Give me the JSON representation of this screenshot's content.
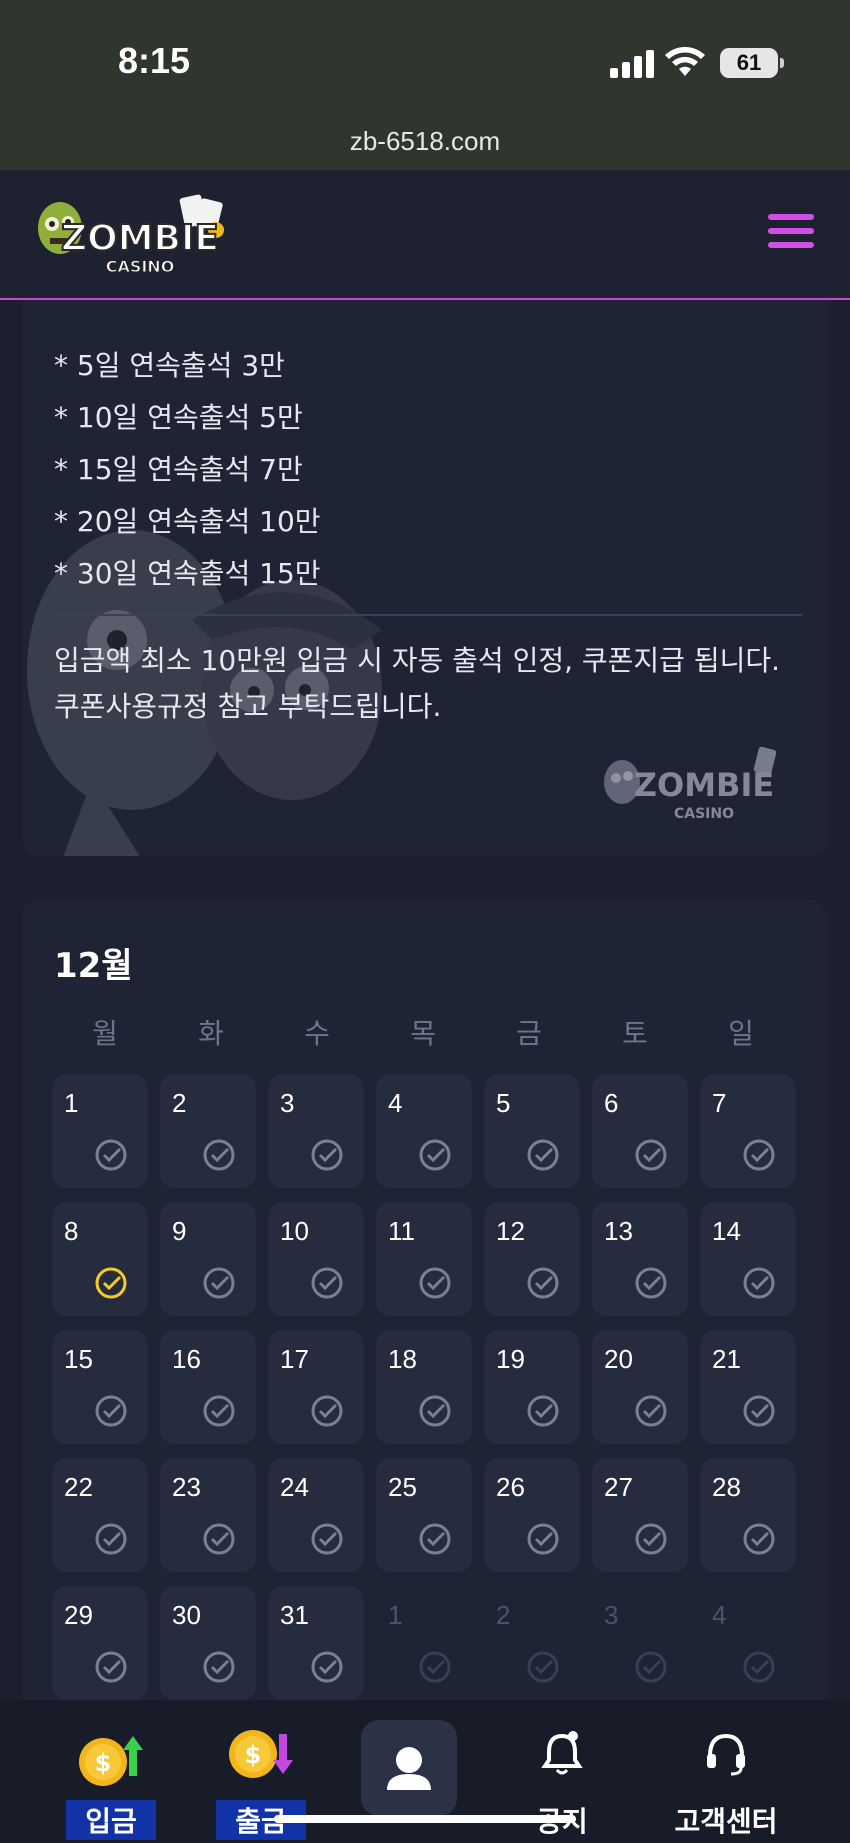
{
  "status": {
    "time": "8:15",
    "battery": "61"
  },
  "browser": {
    "url": "zb-6518.com"
  },
  "header": {
    "logo_text": "ZOMBIE",
    "logo_sub": "CASINO"
  },
  "bonus": {
    "items": [
      "* 5일 연속출석 3만",
      "* 10일 연속출석 5만",
      "* 15일 연속출석 7만",
      "* 20일 연속출석 10만",
      "* 30일 연속출석 15만"
    ],
    "notice_line1": "입금액 최소 10만원 입금 시 자동 출석 인정, 쿠폰지급 됩니다.",
    "notice_line2": "쿠폰사용규정 참고 부탁드립니다."
  },
  "calendar": {
    "month": "12월",
    "weekdays": [
      "월",
      "화",
      "수",
      "목",
      "금",
      "토",
      "일"
    ],
    "days": [
      {
        "n": "1",
        "checked": false,
        "other": false
      },
      {
        "n": "2",
        "checked": false,
        "other": false
      },
      {
        "n": "3",
        "checked": false,
        "other": false
      },
      {
        "n": "4",
        "checked": false,
        "other": false
      },
      {
        "n": "5",
        "checked": false,
        "other": false
      },
      {
        "n": "6",
        "checked": false,
        "other": false
      },
      {
        "n": "7",
        "checked": false,
        "other": false
      },
      {
        "n": "8",
        "checked": true,
        "other": false
      },
      {
        "n": "9",
        "checked": false,
        "other": false
      },
      {
        "n": "10",
        "checked": false,
        "other": false
      },
      {
        "n": "11",
        "checked": false,
        "other": false
      },
      {
        "n": "12",
        "checked": false,
        "other": false
      },
      {
        "n": "13",
        "checked": false,
        "other": false
      },
      {
        "n": "14",
        "checked": false,
        "other": false
      },
      {
        "n": "15",
        "checked": false,
        "other": false
      },
      {
        "n": "16",
        "checked": false,
        "other": false
      },
      {
        "n": "17",
        "checked": false,
        "other": false
      },
      {
        "n": "18",
        "checked": false,
        "other": false
      },
      {
        "n": "19",
        "checked": false,
        "other": false
      },
      {
        "n": "20",
        "checked": false,
        "other": false
      },
      {
        "n": "21",
        "checked": false,
        "other": false
      },
      {
        "n": "22",
        "checked": false,
        "other": false
      },
      {
        "n": "23",
        "checked": false,
        "other": false
      },
      {
        "n": "24",
        "checked": false,
        "other": false
      },
      {
        "n": "25",
        "checked": false,
        "other": false
      },
      {
        "n": "26",
        "checked": false,
        "other": false
      },
      {
        "n": "27",
        "checked": false,
        "other": false
      },
      {
        "n": "28",
        "checked": false,
        "other": false
      },
      {
        "n": "29",
        "checked": false,
        "other": false
      },
      {
        "n": "30",
        "checked": false,
        "other": false
      },
      {
        "n": "31",
        "checked": false,
        "other": false
      },
      {
        "n": "1",
        "checked": false,
        "other": true
      },
      {
        "n": "2",
        "checked": false,
        "other": true
      },
      {
        "n": "3",
        "checked": false,
        "other": true
      },
      {
        "n": "4",
        "checked": false,
        "other": true
      }
    ]
  },
  "nav": {
    "deposit": "입금",
    "withdraw": "출금",
    "notice": "공지",
    "support": "고객센터"
  },
  "colors": {
    "accent": "#d24ee8",
    "checked": "#f2cd2a",
    "unchecked": "#7b8194"
  }
}
